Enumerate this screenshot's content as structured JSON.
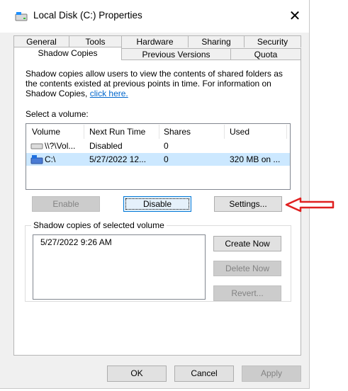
{
  "window": {
    "title": "Local Disk (C:) Properties"
  },
  "tabs": {
    "back_row": [
      "General",
      "Tools",
      "Hardware",
      "Sharing",
      "Security"
    ],
    "front_row": [
      "Shadow Copies",
      "Previous Versions",
      "Quota"
    ],
    "active": "Shadow Copies"
  },
  "description": {
    "text": "Shadow copies allow users to view the contents of shared folders as the contents existed at previous points in time. For information on Shadow Copies,",
    "link": "click here."
  },
  "volume_select_label": "Select a volume:",
  "volume_table": {
    "columns": [
      "Volume",
      "Next Run Time",
      "Shares",
      "Used"
    ],
    "rows": [
      {
        "volume": "\\\\?\\Vol...",
        "next_run": "Disabled",
        "shares": "0",
        "used": "",
        "icon": "drive-icon"
      },
      {
        "volume": "C:\\",
        "next_run": "5/27/2022 12...",
        "shares": "0",
        "used": "320 MB on ...",
        "icon": "system-drive-icon",
        "selected": true
      }
    ]
  },
  "buttons": {
    "enable": "Enable",
    "disable": "Disable",
    "settings": "Settings...",
    "create_now": "Create Now",
    "delete_now": "Delete Now",
    "revert": "Revert...",
    "ok": "OK",
    "cancel": "Cancel",
    "apply": "Apply"
  },
  "copies_group": {
    "label": "Shadow copies of selected volume",
    "items": [
      "5/27/2022 9:26 AM"
    ]
  },
  "colors": {
    "selection": "#cce8ff",
    "focus_border": "#0078d7",
    "annotation_arrow": "#e02020",
    "link": "#0066cc"
  }
}
